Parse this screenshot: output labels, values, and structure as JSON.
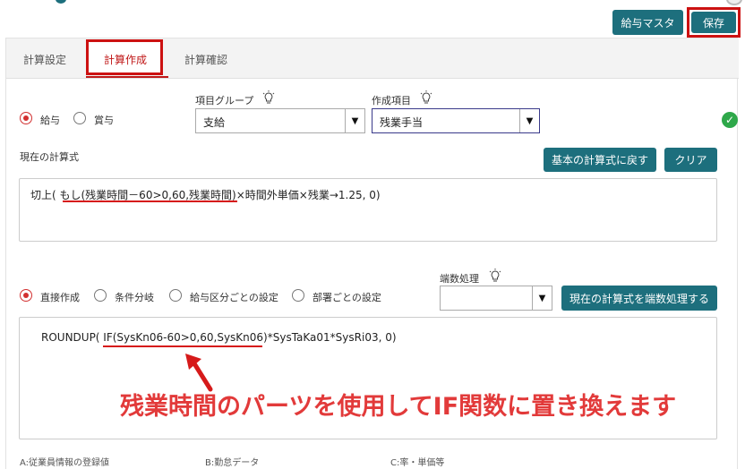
{
  "header": {
    "salary_master_label": "給与マスタ",
    "save_label": "保存"
  },
  "tabs": [
    {
      "label": "計算設定"
    },
    {
      "label": "計算作成"
    },
    {
      "label": "計算確認"
    }
  ],
  "pay_type": {
    "options": [
      {
        "label": "給与",
        "selected": true
      },
      {
        "label": "賞与",
        "selected": false
      }
    ]
  },
  "item_group": {
    "label": "項目グループ",
    "value": "支給"
  },
  "created_item": {
    "label": "作成項目",
    "value": "残業手当"
  },
  "current_formula": {
    "label": "現在の計算式",
    "reset_label": "基本の計算式に戻す",
    "clear_label": "クリア",
    "text": "切上( もし(残業時間－60>0,60,残業時間)×時間外単価×残業→1.25, 0)"
  },
  "mode": {
    "options": [
      {
        "label": "直接作成",
        "selected": true
      },
      {
        "label": "条件分岐",
        "selected": false
      },
      {
        "label": "給与区分ごとの設定",
        "selected": false
      },
      {
        "label": "部署ごとの設定",
        "selected": false
      }
    ]
  },
  "rounding": {
    "label": "端数処理",
    "value": "",
    "apply_label": "現在の計算式を端数処理する"
  },
  "editor": {
    "text": "ROUNDUP( IF(SysKn06-60>0,60,SysKn06)*SysTaKa01*SysRi03, 0)"
  },
  "annotation": {
    "text": "残業時間のパーツを使用してIF関数に置き換えます",
    "color": "#e23a3a"
  },
  "parts_headers": {
    "a": "A:従業員情報の登録値",
    "b": "B:勤怠データ",
    "c": "C:率・単価等"
  },
  "colors": {
    "accent": "#1d6f7d",
    "highlight_red": "#cc1111",
    "ok_green": "#2ea84a"
  }
}
